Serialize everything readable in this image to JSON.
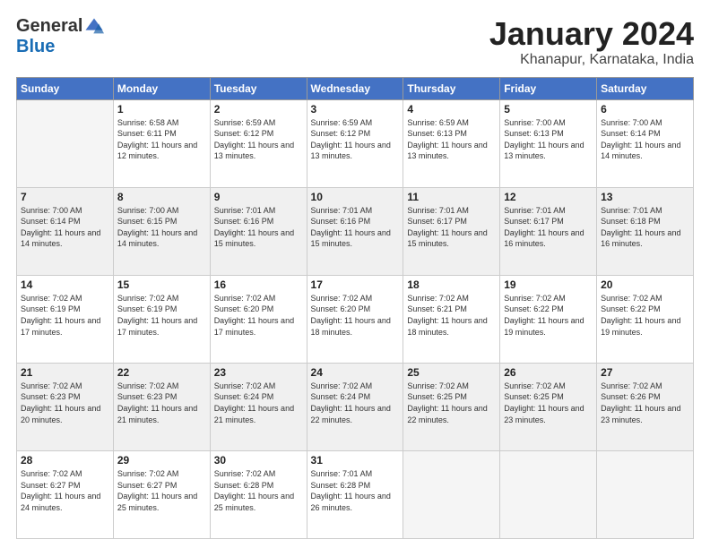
{
  "header": {
    "logo_general": "General",
    "logo_blue": "Blue",
    "month_title": "January 2024",
    "location": "Khanapur, Karnataka, India"
  },
  "weekdays": [
    "Sunday",
    "Monday",
    "Tuesday",
    "Wednesday",
    "Thursday",
    "Friday",
    "Saturday"
  ],
  "weeks": [
    [
      {
        "day": "",
        "empty": true
      },
      {
        "day": "1",
        "sunrise": "6:58 AM",
        "sunset": "6:11 PM",
        "daylight": "11 hours and 12 minutes."
      },
      {
        "day": "2",
        "sunrise": "6:59 AM",
        "sunset": "6:12 PM",
        "daylight": "11 hours and 13 minutes."
      },
      {
        "day": "3",
        "sunrise": "6:59 AM",
        "sunset": "6:12 PM",
        "daylight": "11 hours and 13 minutes."
      },
      {
        "day": "4",
        "sunrise": "6:59 AM",
        "sunset": "6:13 PM",
        "daylight": "11 hours and 13 minutes."
      },
      {
        "day": "5",
        "sunrise": "7:00 AM",
        "sunset": "6:13 PM",
        "daylight": "11 hours and 13 minutes."
      },
      {
        "day": "6",
        "sunrise": "7:00 AM",
        "sunset": "6:14 PM",
        "daylight": "11 hours and 14 minutes."
      }
    ],
    [
      {
        "day": "7",
        "sunrise": "7:00 AM",
        "sunset": "6:14 PM",
        "daylight": "11 hours and 14 minutes."
      },
      {
        "day": "8",
        "sunrise": "7:00 AM",
        "sunset": "6:15 PM",
        "daylight": "11 hours and 14 minutes."
      },
      {
        "day": "9",
        "sunrise": "7:01 AM",
        "sunset": "6:16 PM",
        "daylight": "11 hours and 15 minutes."
      },
      {
        "day": "10",
        "sunrise": "7:01 AM",
        "sunset": "6:16 PM",
        "daylight": "11 hours and 15 minutes."
      },
      {
        "day": "11",
        "sunrise": "7:01 AM",
        "sunset": "6:17 PM",
        "daylight": "11 hours and 15 minutes."
      },
      {
        "day": "12",
        "sunrise": "7:01 AM",
        "sunset": "6:17 PM",
        "daylight": "11 hours and 16 minutes."
      },
      {
        "day": "13",
        "sunrise": "7:01 AM",
        "sunset": "6:18 PM",
        "daylight": "11 hours and 16 minutes."
      }
    ],
    [
      {
        "day": "14",
        "sunrise": "7:02 AM",
        "sunset": "6:19 PM",
        "daylight": "11 hours and 17 minutes."
      },
      {
        "day": "15",
        "sunrise": "7:02 AM",
        "sunset": "6:19 PM",
        "daylight": "11 hours and 17 minutes."
      },
      {
        "day": "16",
        "sunrise": "7:02 AM",
        "sunset": "6:20 PM",
        "daylight": "11 hours and 17 minutes."
      },
      {
        "day": "17",
        "sunrise": "7:02 AM",
        "sunset": "6:20 PM",
        "daylight": "11 hours and 18 minutes."
      },
      {
        "day": "18",
        "sunrise": "7:02 AM",
        "sunset": "6:21 PM",
        "daylight": "11 hours and 18 minutes."
      },
      {
        "day": "19",
        "sunrise": "7:02 AM",
        "sunset": "6:22 PM",
        "daylight": "11 hours and 19 minutes."
      },
      {
        "day": "20",
        "sunrise": "7:02 AM",
        "sunset": "6:22 PM",
        "daylight": "11 hours and 19 minutes."
      }
    ],
    [
      {
        "day": "21",
        "sunrise": "7:02 AM",
        "sunset": "6:23 PM",
        "daylight": "11 hours and 20 minutes."
      },
      {
        "day": "22",
        "sunrise": "7:02 AM",
        "sunset": "6:23 PM",
        "daylight": "11 hours and 21 minutes."
      },
      {
        "day": "23",
        "sunrise": "7:02 AM",
        "sunset": "6:24 PM",
        "daylight": "11 hours and 21 minutes."
      },
      {
        "day": "24",
        "sunrise": "7:02 AM",
        "sunset": "6:24 PM",
        "daylight": "11 hours and 22 minutes."
      },
      {
        "day": "25",
        "sunrise": "7:02 AM",
        "sunset": "6:25 PM",
        "daylight": "11 hours and 22 minutes."
      },
      {
        "day": "26",
        "sunrise": "7:02 AM",
        "sunset": "6:25 PM",
        "daylight": "11 hours and 23 minutes."
      },
      {
        "day": "27",
        "sunrise": "7:02 AM",
        "sunset": "6:26 PM",
        "daylight": "11 hours and 23 minutes."
      }
    ],
    [
      {
        "day": "28",
        "sunrise": "7:02 AM",
        "sunset": "6:27 PM",
        "daylight": "11 hours and 24 minutes."
      },
      {
        "day": "29",
        "sunrise": "7:02 AM",
        "sunset": "6:27 PM",
        "daylight": "11 hours and 25 minutes."
      },
      {
        "day": "30",
        "sunrise": "7:02 AM",
        "sunset": "6:28 PM",
        "daylight": "11 hours and 25 minutes."
      },
      {
        "day": "31",
        "sunrise": "7:01 AM",
        "sunset": "6:28 PM",
        "daylight": "11 hours and 26 minutes."
      },
      {
        "day": "",
        "empty": true
      },
      {
        "day": "",
        "empty": true
      },
      {
        "day": "",
        "empty": true
      }
    ]
  ]
}
